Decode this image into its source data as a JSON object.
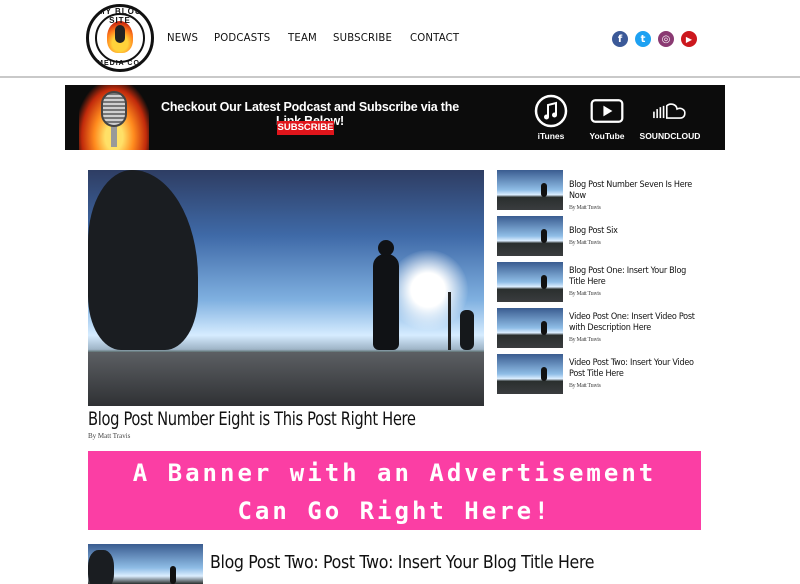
{
  "logo": {
    "top_text": "MY BLOG SITE",
    "bottom_text": "MEDIA CO."
  },
  "nav": [
    "NEWS",
    "PODCASTS",
    "TEAM",
    "SUBSCRIBE",
    "CONTACT"
  ],
  "social": [
    {
      "name": "facebook-icon",
      "glyph": "f",
      "color": "#3b5998"
    },
    {
      "name": "twitter-icon",
      "glyph": "t",
      "color": "#1da1f2"
    },
    {
      "name": "instagram-icon",
      "glyph": "◎",
      "color": "#8a3a72"
    },
    {
      "name": "youtube-icon",
      "glyph": "▶",
      "color": "#cc181e"
    }
  ],
  "promo": {
    "message": "Checkout Our Latest Podcast and Subscribe via the Link Below!",
    "subscribe_label": "SUBSCRIBE",
    "platforms": [
      {
        "label": "iTunes",
        "icon": "itunes-icon"
      },
      {
        "label": "YouTube",
        "icon": "youtube-play-icon"
      },
      {
        "label": "SOUNDCLOUD",
        "icon": "soundcloud-icon"
      }
    ]
  },
  "hero": {
    "title": "Blog Post Number Eight is This Post Right Here",
    "byline": "By Matt Travis"
  },
  "sidebar_posts": [
    {
      "title": "Blog Post Number Seven Is Here Now",
      "byline": "By Matt Travis"
    },
    {
      "title": "Blog Post Six",
      "byline": "By Matt Travis"
    },
    {
      "title": "Blog Post One: Insert Your Blog Title Here",
      "byline": "By Matt Travis"
    },
    {
      "title": "Video Post One: Insert Video Post with Description Here",
      "byline": "By Matt Travis"
    },
    {
      "title": "Video Post Two: Insert Your Video Post Title Here",
      "byline": "By Matt Travis"
    }
  ],
  "ad": {
    "line1": "A Banner with an Advertisement",
    "line2": "Can Go Right Here!",
    "color": "#fb3ea4"
  },
  "bottom_post": {
    "title": "Blog Post Two: Post Two: Insert Your Blog Title Here"
  }
}
